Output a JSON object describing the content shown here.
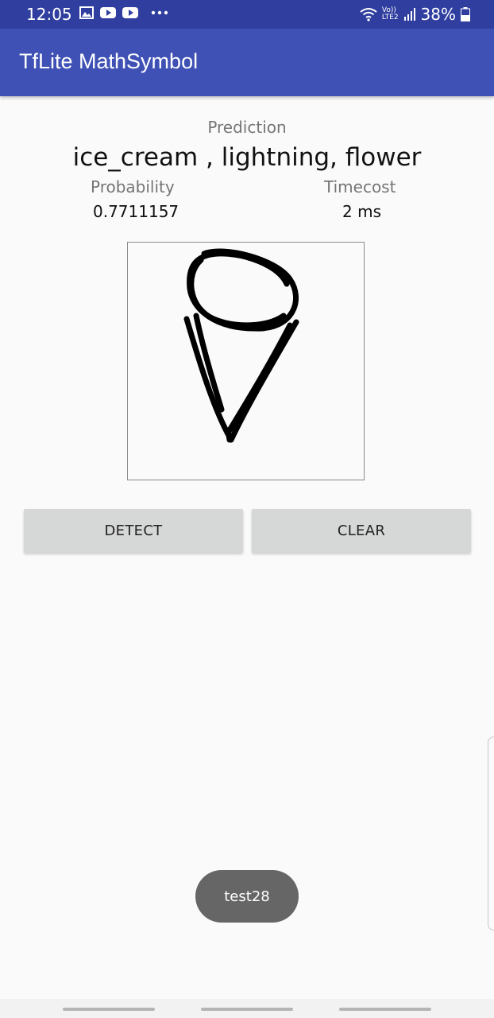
{
  "status_bar": {
    "time": "12:05",
    "battery": "38%",
    "icons": [
      "image-icon",
      "youtube-icon",
      "youtube-icon",
      "more-dots-icon",
      "wifi-icon",
      "volte-lte2-icon",
      "signal-icon",
      "battery-icon"
    ],
    "network_label_top": "Vo))",
    "network_label_bottom": "LTE2"
  },
  "app_bar": {
    "title": "TfLite MathSymbol"
  },
  "prediction": {
    "label": "Prediction",
    "value": "ice_cream , lightning, flower"
  },
  "probability": {
    "label": "Probability",
    "value": "0.7711157"
  },
  "timecost": {
    "label": "Timecost",
    "value": "2 ms"
  },
  "buttons": {
    "detect": "DETECT",
    "clear": "CLEAR"
  },
  "toast": {
    "text": "test28"
  },
  "colors": {
    "status_bar": "#303f9f",
    "app_bar": "#3f51b5",
    "button_bg": "#d6d7d7",
    "toast_bg": "#666666"
  }
}
